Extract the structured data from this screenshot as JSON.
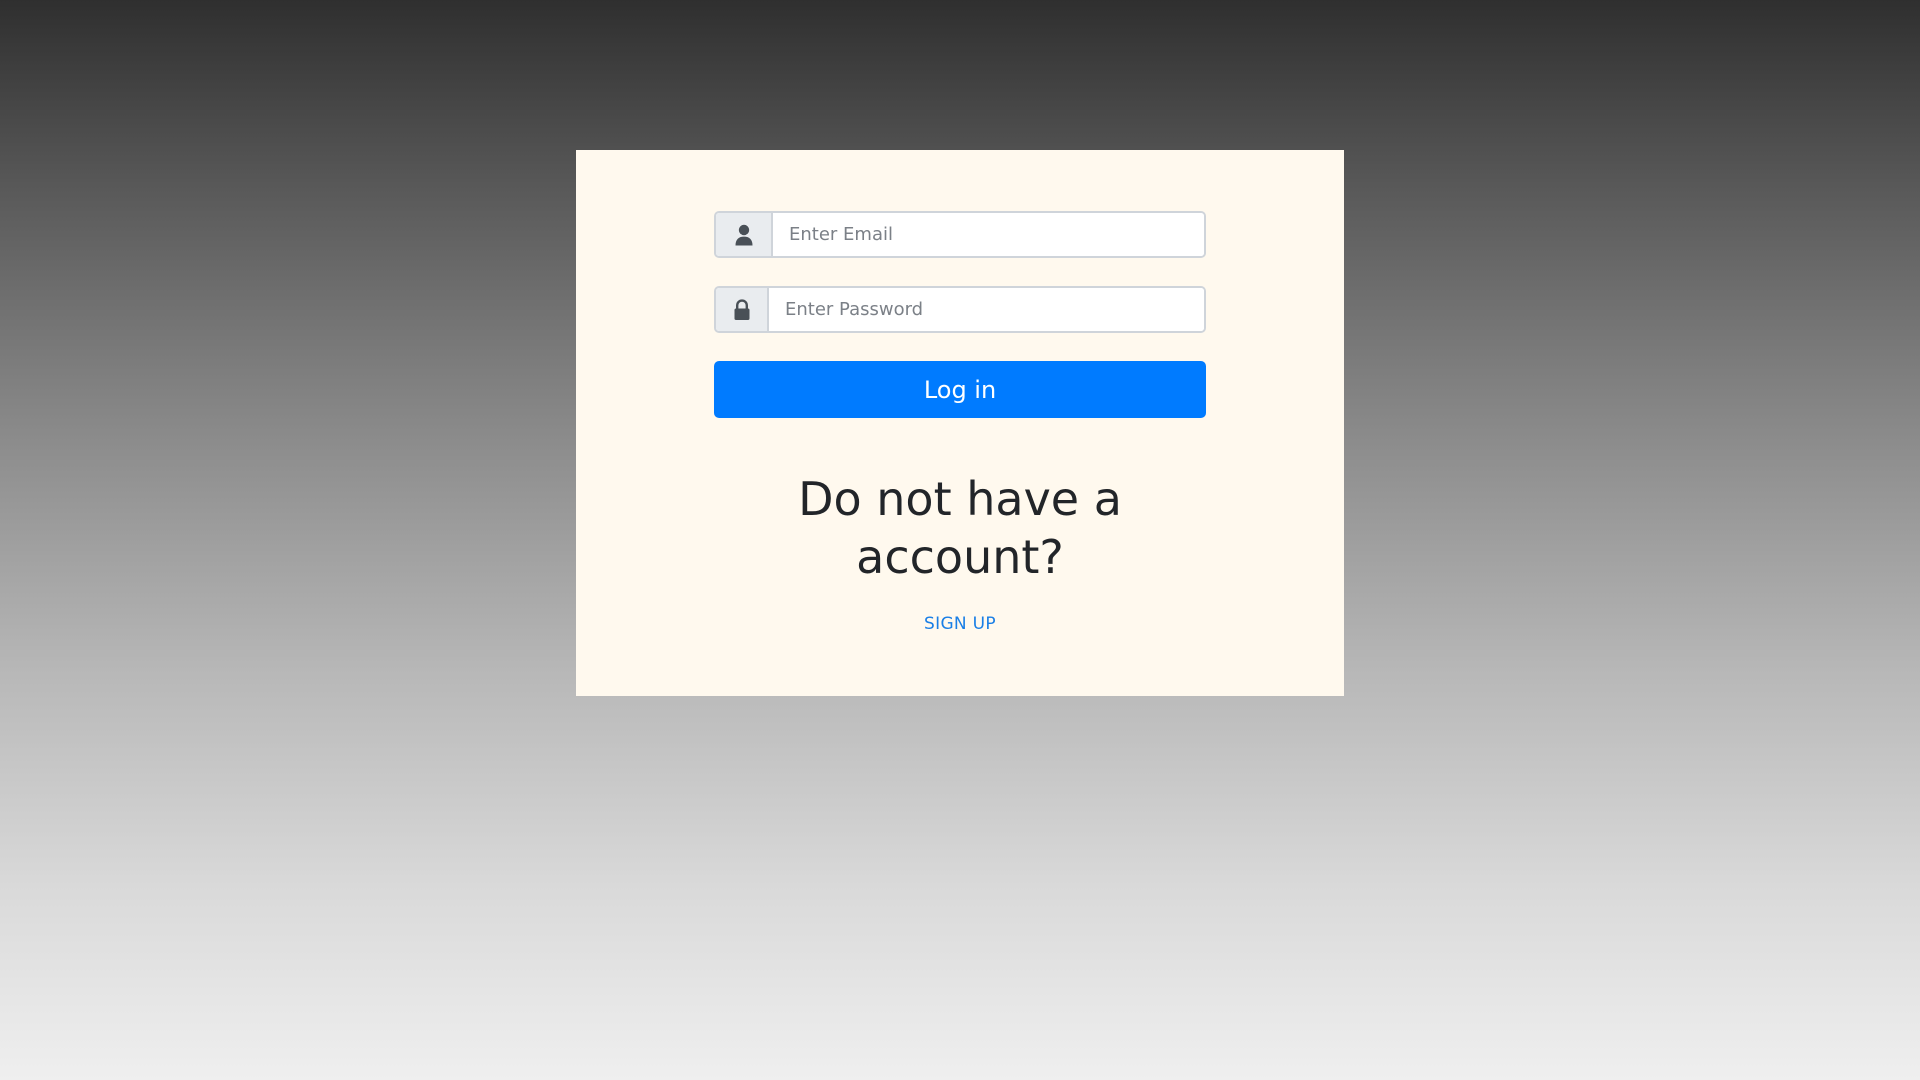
{
  "login_form": {
    "email_icon": "user-icon",
    "email_placeholder": "Enter Email",
    "email_value": "",
    "password_icon": "lock-icon",
    "password_placeholder": "Enter Password",
    "password_value": "",
    "login_label": "Log in"
  },
  "signup": {
    "heading": "Do not have a account?",
    "link_label": "SIGN UP"
  },
  "colors": {
    "card_background": "#fff9ee",
    "primary_button": "#007bff",
    "link": "#1a7fe6",
    "addon_background": "#e9ecef"
  }
}
